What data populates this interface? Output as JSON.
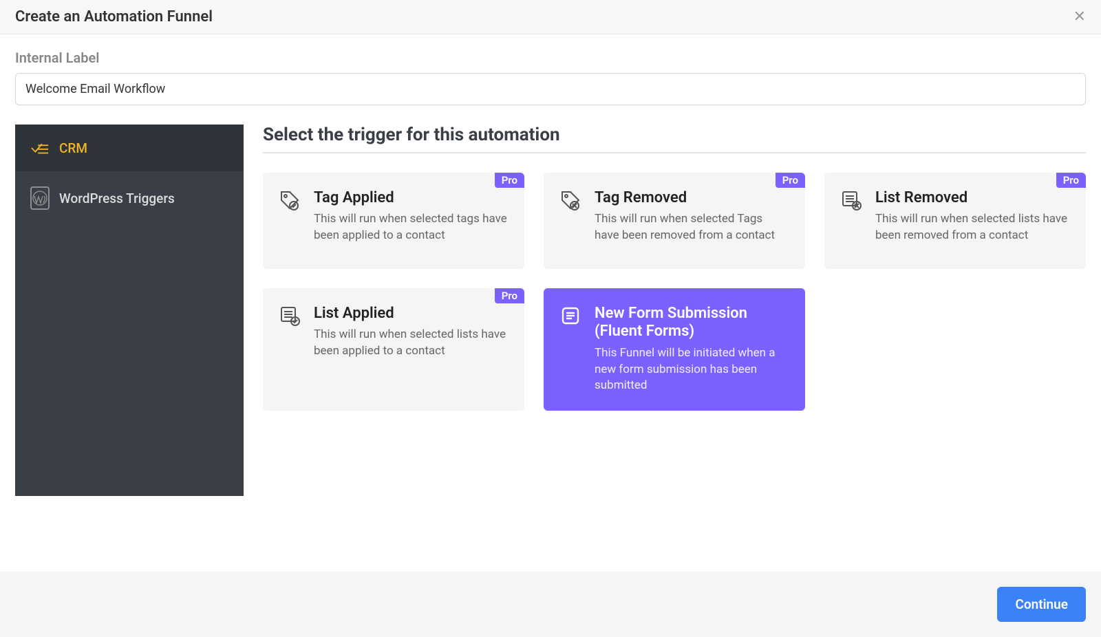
{
  "header": {
    "title": "Create an Automation Funnel"
  },
  "form": {
    "internal_label": "Internal Label",
    "internal_value": "Welcome Email Workflow"
  },
  "sidebar": {
    "items": [
      {
        "label": "CRM",
        "icon": "crm-icon",
        "active": true
      },
      {
        "label": "WordPress Triggers",
        "icon": "wordpress-icon",
        "active": false
      }
    ]
  },
  "main": {
    "section_title": "Select the trigger for this automation",
    "pro_label": "Pro",
    "triggers": [
      {
        "title": "Tag Applied",
        "desc": "This will run when selected tags have been applied to a contact",
        "pro": true,
        "selected": false,
        "icon": "tag-check-icon"
      },
      {
        "title": "Tag Removed",
        "desc": "This will run when selected Tags have been removed from a contact",
        "pro": true,
        "selected": false,
        "icon": "tag-remove-icon"
      },
      {
        "title": "List Removed",
        "desc": "This will run when selected lists have been removed from a contact",
        "pro": true,
        "selected": false,
        "icon": "list-remove-icon"
      },
      {
        "title": "List Applied",
        "desc": "This will run when selected lists have been applied to a contact",
        "pro": true,
        "selected": false,
        "icon": "list-check-icon"
      },
      {
        "title": "New Form Submission (Fluent Forms)",
        "desc": "This Funnel will be initiated when a new form submission has been submitted",
        "pro": false,
        "selected": true,
        "icon": "form-icon"
      }
    ]
  },
  "footer": {
    "continue_label": "Continue"
  }
}
